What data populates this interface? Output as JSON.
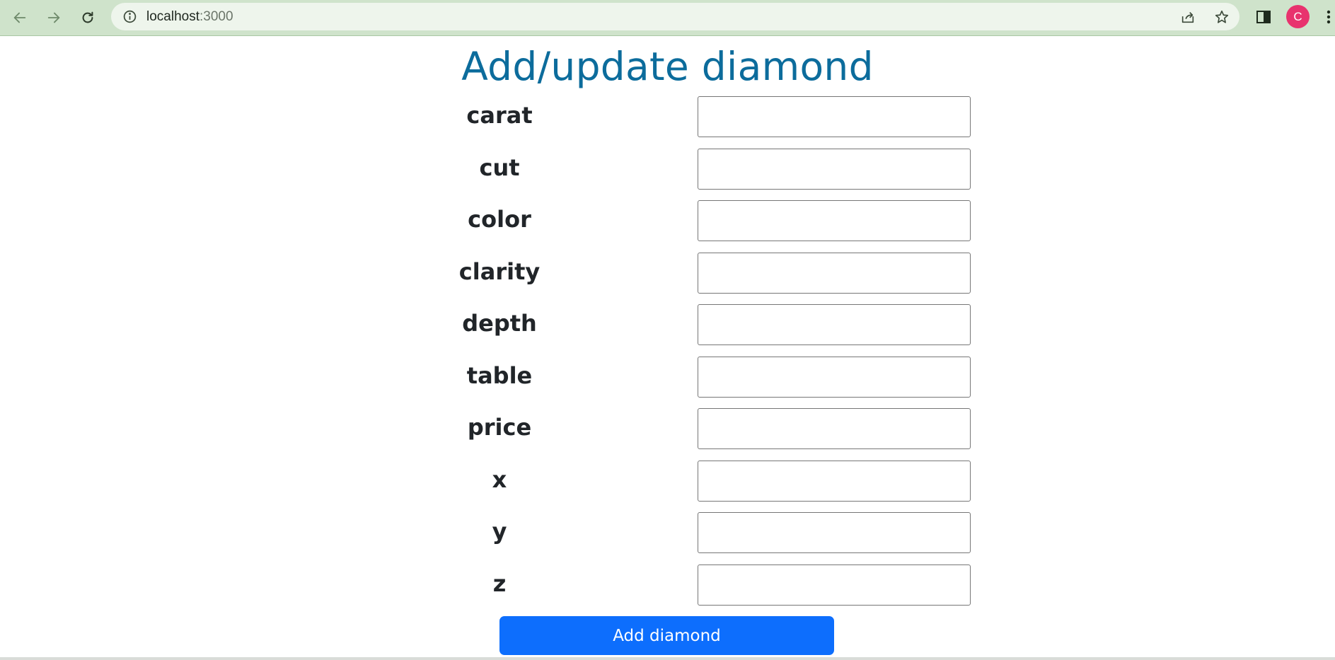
{
  "browser": {
    "url_host": "localhost",
    "url_port": ":3000",
    "avatar_letter": "C",
    "icons": {
      "back": "arrow-left-icon",
      "forward": "arrow-right-icon",
      "reload": "reload-icon",
      "info": "info-icon",
      "share": "share-icon",
      "bookmark": "star-icon",
      "side_panel": "side-panel-icon",
      "menu": "kebab-menu-icon"
    },
    "colors": {
      "toolbar": "#cfe3cb",
      "omnibox": "#eef5ec",
      "avatar": "#e8336e"
    }
  },
  "page": {
    "title": "Add/update diamond",
    "fields": [
      {
        "label": "carat",
        "value": "",
        "placeholder": ""
      },
      {
        "label": "cut",
        "value": "",
        "placeholder": ""
      },
      {
        "label": "color",
        "value": "",
        "placeholder": ""
      },
      {
        "label": "clarity",
        "value": "",
        "placeholder": ""
      },
      {
        "label": "depth",
        "value": "",
        "placeholder": ""
      },
      {
        "label": "table",
        "value": "",
        "placeholder": ""
      },
      {
        "label": "price",
        "value": "",
        "placeholder": ""
      },
      {
        "label": "x",
        "value": "",
        "placeholder": ""
      },
      {
        "label": "y",
        "value": "",
        "placeholder": ""
      },
      {
        "label": "z",
        "value": "",
        "placeholder": ""
      }
    ],
    "submit_label": "Add diamond",
    "colors": {
      "title": "#0c6c9c",
      "button": "#0d6efd"
    }
  }
}
